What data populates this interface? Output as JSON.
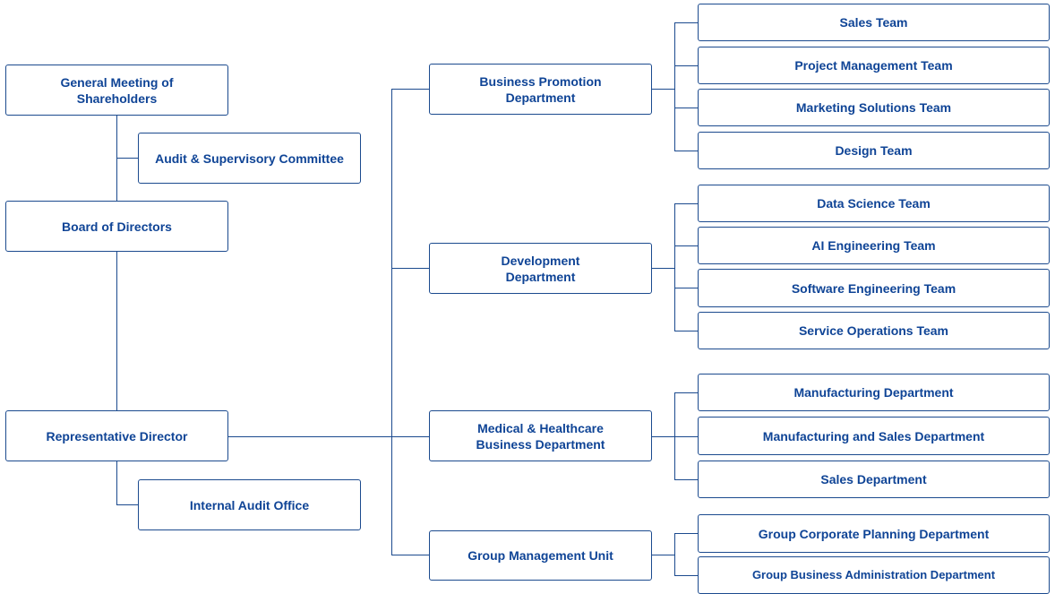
{
  "colors": {
    "line": "#1b4a8e",
    "text": "#0f4496",
    "background": "#ffffff"
  },
  "governance": {
    "general_meeting": "General Meeting of\nShareholders",
    "audit_committee": "Audit & Supervisory Committee",
    "board": "Board of Directors",
    "representative_director": "Representative Director",
    "internal_audit": "Internal Audit Office"
  },
  "departments": [
    {
      "name": "Business Promotion\nDepartment",
      "units": [
        "Sales Team",
        "Project Management Team",
        "Marketing Solutions Team",
        "Design Team"
      ]
    },
    {
      "name": "Development\nDepartment",
      "units": [
        "Data Science Team",
        "AI Engineering Team",
        "Software Engineering Team",
        "Service Operations Team"
      ]
    },
    {
      "name": "Medical & Healthcare\nBusiness Department",
      "units": [
        "Manufacturing Department",
        "Manufacturing and Sales Department",
        "Sales Department"
      ]
    },
    {
      "name": "Group Management Unit",
      "units": [
        "Group Corporate Planning Department",
        "Group Business Administration Department"
      ]
    }
  ]
}
